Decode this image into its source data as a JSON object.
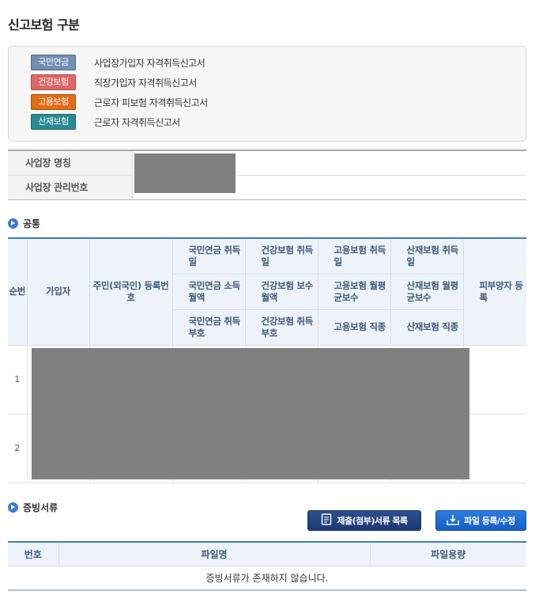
{
  "page_title": "신고보험 구분",
  "legend": [
    {
      "badge": "국민연금",
      "desc": "사업장가입자 자격취득신고서",
      "color": "#6f8fb3"
    },
    {
      "badge": "건강보험",
      "desc": "직장가입자 자격취득신고서",
      "color": "#e06767"
    },
    {
      "badge": "고용보험",
      "desc": "근로자 피보험 자격취득신고서",
      "color": "#e46c16"
    },
    {
      "badge": "산재보험",
      "desc": "근로자 자격취득신고서",
      "color": "#2a8a93"
    }
  ],
  "workplace": {
    "name_label": "사업장 명칭",
    "mgmt_no_label": "사업장 관리번호"
  },
  "common": {
    "section_title": "공통",
    "headers": {
      "seq": "순번",
      "subscriber": "가입자",
      "resident_no": "주민(외국인) 등록번호",
      "row1": [
        "국민연금 취득일",
        "건강보험 취득일",
        "고용보험 취득일",
        "산재보험 취득일"
      ],
      "row2": [
        "국민연금 소득월액",
        "건강보험 보수월액",
        "고용보험 월평균보수",
        "산재보험 월평균보수"
      ],
      "row3": [
        "국민연금 취득부호",
        "건강보험 취득부호",
        "고용보험 직종",
        "산재보험 직종"
      ],
      "dependents": "피부양자 등록"
    },
    "rows": [
      {
        "seq": "1"
      },
      {
        "seq": "2"
      }
    ]
  },
  "evidence": {
    "section_title": "증빙서류",
    "list_button": "제출(첨부)서류 목록",
    "upload_button": "파일 등록/수정",
    "columns": [
      "번호",
      "파일명",
      "파일용량"
    ],
    "empty_message": "증빙서류가 존재하지 않습니다."
  }
}
